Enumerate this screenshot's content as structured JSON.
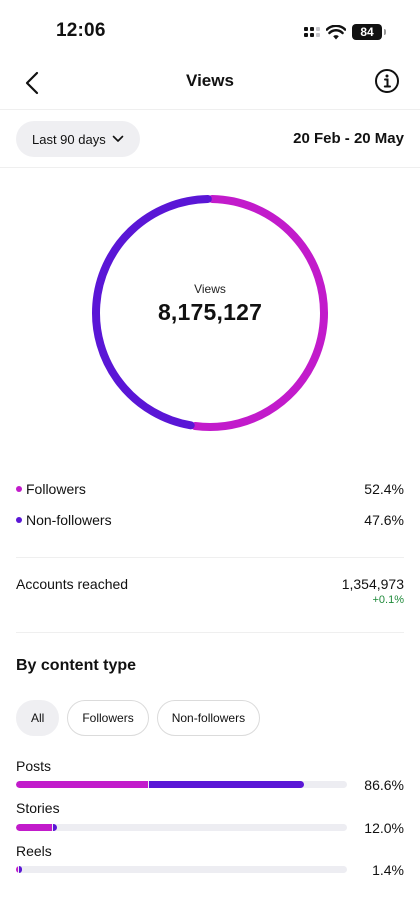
{
  "status": {
    "time": "12:06",
    "battery": "84"
  },
  "nav": {
    "title": "Views",
    "back_icon": "chevron-left-icon",
    "info_icon": "info-icon"
  },
  "filter": {
    "range_label": "Last 90 days",
    "date_range": "20 Feb - 20 May"
  },
  "colors": {
    "followers": "#c21bcb",
    "non_followers": "#5a16d6",
    "track": "#ededf2",
    "positive": "#1f8a3a"
  },
  "summary": {
    "label": "Views",
    "total": "8,175,127"
  },
  "chart_data": {
    "type": "pie",
    "series": [
      {
        "name": "Followers",
        "value": 52.4
      },
      {
        "name": "Non-followers",
        "value": 47.6
      }
    ]
  },
  "legend": [
    {
      "name": "Followers",
      "percent": "52.4%"
    },
    {
      "name": "Non-followers",
      "percent": "47.6%"
    }
  ],
  "reached": {
    "label": "Accounts reached",
    "value": "1,354,973",
    "change": "+0.1%"
  },
  "content_type": {
    "title": "By content type",
    "chips": [
      "All",
      "Followers",
      "Non-followers"
    ],
    "active_chip": "All",
    "rows": [
      {
        "label": "Posts",
        "percent": "86.6%",
        "followers_fraction": 0.4,
        "non_followers_fraction": 0.466
      },
      {
        "label": "Stories",
        "percent": "12.0%",
        "followers_fraction": 0.11,
        "non_followers_fraction": 0.01
      },
      {
        "label": "Reels",
        "percent": "1.4%",
        "followers_fraction": 0.005,
        "non_followers_fraction": 0.009
      }
    ]
  }
}
